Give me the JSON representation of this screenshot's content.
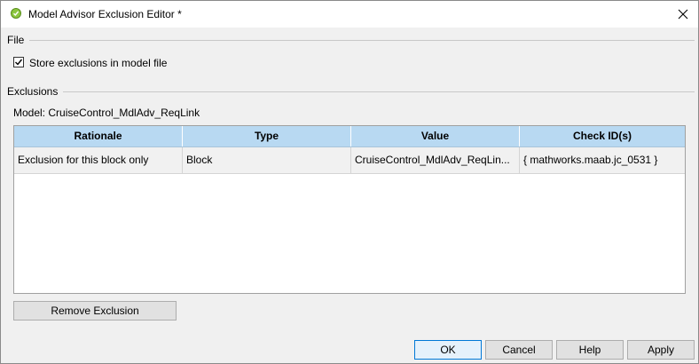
{
  "window": {
    "title": "Model Advisor Exclusion Editor *"
  },
  "file_section": {
    "label": "File",
    "store_checkbox_label": "Store exclusions in model file",
    "store_checked": true
  },
  "exclusions_section": {
    "label": "Exclusions",
    "model_label": "Model: CruiseControl_MdlAdv_ReqLink"
  },
  "table": {
    "columns": [
      "Rationale",
      "Type",
      "Value",
      "Check ID(s)"
    ],
    "rows": [
      {
        "rationale": "Exclusion for this block only",
        "type": "Block",
        "value": "CruiseControl_MdlAdv_ReqLin...",
        "check_ids": "{ mathworks.maab.jc_0531 }"
      }
    ]
  },
  "buttons": {
    "remove_exclusion": "Remove Exclusion",
    "ok": "OK",
    "cancel": "Cancel",
    "help": "Help",
    "apply": "Apply"
  },
  "colors": {
    "header_bg": "#b8d9f2",
    "default_button_border": "#0078d7",
    "title_icon": "#8cc63f"
  }
}
